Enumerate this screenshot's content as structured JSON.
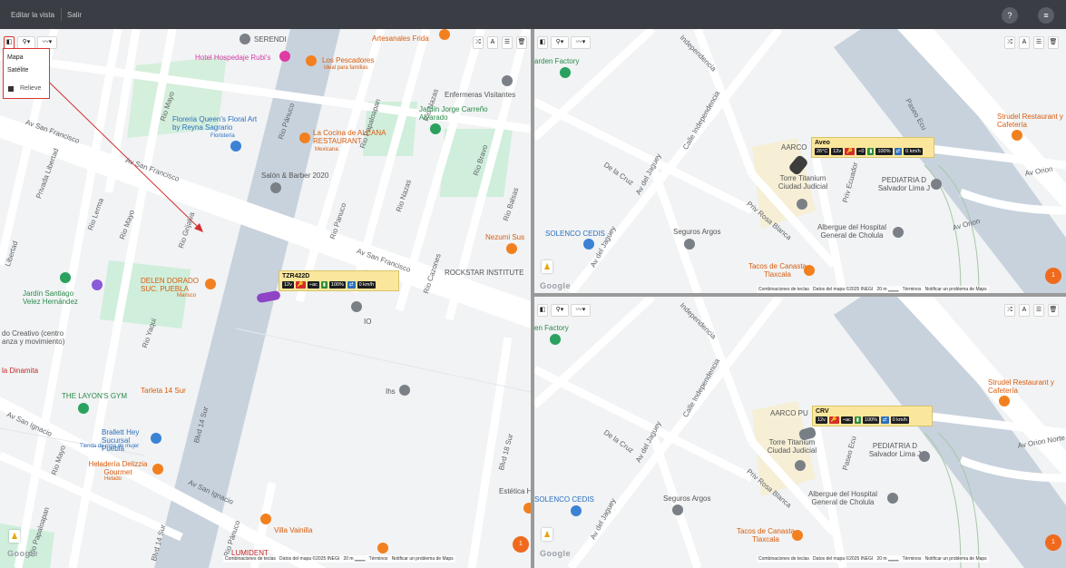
{
  "topbar": {
    "tabs": [
      "Editar la vista",
      "Salir"
    ],
    "right_icons": [
      "help-icon",
      "menu-icon"
    ],
    "help_glyph": "?",
    "menu_glyph": "≡"
  },
  "controls": {
    "layers_glyph": "◧",
    "pin_glyph": "⚲▾",
    "route_glyph": "〰▾",
    "shuffle_glyph": "⤮",
    "car_glyph": "A",
    "list_glyph": "☰",
    "trash_glyph": "🗑"
  },
  "menu": {
    "items": [
      "Mapa",
      "Satélite",
      "Relieve"
    ]
  },
  "map_left": {
    "places": [
      {
        "name": "SERENDI"
      },
      {
        "name": "Artesanales Frida"
      },
      {
        "name": "Hotel Hospedaje Rubi's"
      },
      {
        "name": "Los Pescadores",
        "sub": "Ideal para familias"
      },
      {
        "name": "Enfermeras Visitantes"
      },
      {
        "name": "Jardín Jorge Carreño Alvarado"
      },
      {
        "name": "Floreria Queen's Floral Art by Reyna Sagrario",
        "sub": "Floristería"
      },
      {
        "name": "La Cocina de ALEANA RESTAURANT",
        "sub": "Mexicana"
      },
      {
        "name": "Salón & Barber 2020"
      },
      {
        "name": "Nezumi Sus"
      },
      {
        "name": "ROCKSTAR INSTITUTE"
      },
      {
        "name": "DELEN DORADO SUC. PUEBLA",
        "sub": "Marisco"
      },
      {
        "name": "Jardín Santiago Velez Hernández"
      },
      {
        "name": "do Creativo (centro anza y movimiento)"
      },
      {
        "name": "la Dinamita"
      },
      {
        "name": "THE LAYON'S GYM"
      },
      {
        "name": "Tarleta 14 Sur"
      },
      {
        "name": "Brallett Hey Sucursal Puebla",
        "sub": "Tienda de ropa de mujer"
      },
      {
        "name": "Heladería Delizzia Gourmet",
        "sub": "Helado"
      },
      {
        "name": "Villa Vainilla"
      },
      {
        "name": "LUMIDENT"
      },
      {
        "name": "IO"
      },
      {
        "name": "Ihs"
      },
      {
        "name": "Estética H"
      }
    ],
    "roads": [
      "Av San Francisco",
      "Av San Francisco",
      "Av San Francisco",
      "Privada Libertad",
      "Rio Lerma",
      "Rio Mayo",
      "Rio Balsas",
      "Rio Grijalva",
      "Rio Panuco",
      "Rio Nazas",
      "Rio Papaloapan",
      "Rio Pánuco",
      "Rio Nazas",
      "Rio Cazones",
      "Rio Bravo",
      "Rio Mayo",
      "Rio Yaqui",
      "Av San Ignacio",
      "Av San Ignacio",
      "Blvd 14 Sur",
      "Blvd 14 Sur",
      "Blvd 18 Sur",
      "Rio Mayo",
      "Rio Papaloapan",
      "Rio Pánuco",
      "Libertad"
    ],
    "vehicle": {
      "name": "TZR422D",
      "chips": [
        "12v",
        "🔑",
        "⌁ac",
        "▮",
        "100%",
        "⇄",
        "0 km/h"
      ]
    },
    "footer": [
      "Combinaciones de teclas",
      "Datos del mapa ©2025 INEGI",
      "20 m",
      "Términos",
      "Notificar un problema de Maps"
    ],
    "google": "Google",
    "fab": "1"
  },
  "map_tr": {
    "places": [
      {
        "name": "arden Factory"
      },
      {
        "name": "AARCO"
      },
      {
        "name": "Strudel Restaurant y Cafetería"
      },
      {
        "name": "Torre Titanium Ciudad Judicial"
      },
      {
        "name": "PEDIATRIA D Salvador Lima J"
      },
      {
        "name": "Albergue del Hospital General de Cholula"
      },
      {
        "name": "Seguros Argos"
      },
      {
        "name": "SOLENCO CEDIS"
      },
      {
        "name": "Tacos de Canasta Tlaxcala"
      }
    ],
    "roads": [
      "Independencia",
      "Calle Independencia",
      "Av del Jaguey",
      "Av del Jaguey",
      "Av Orion",
      "Priv Ecuador",
      "Av Orion",
      "Priv Rosa Blanca",
      "De la Cruz",
      "Paseo Ecu"
    ],
    "vehicle": {
      "name": "Aveo",
      "chips": [
        "26°C",
        "12v",
        "🔑",
        "⌁0",
        "▮",
        "100%",
        "⇄",
        "0 km/h"
      ]
    },
    "footer": [
      "Combinaciones de teclas",
      "Datos del mapa ©2025 INEGI",
      "20 m",
      "Términos",
      "Notificar un problema de Maps"
    ],
    "google": "Google",
    "fab": "1"
  },
  "map_br": {
    "places": [
      {
        "name": "en Factory"
      },
      {
        "name": "AARCO PU"
      },
      {
        "name": "Strudel Restaurant y Cafetería"
      },
      {
        "name": "Torre Titanium Ciudad Judicial"
      },
      {
        "name": "PEDIATRIA D Salvador Lima J"
      },
      {
        "name": "Albergue del Hospital General de Cholula"
      },
      {
        "name": "Seguros Argos"
      },
      {
        "name": "SOLENCO CEDIS"
      },
      {
        "name": "Tacos de Canasta Tlaxcala"
      }
    ],
    "roads": [
      "Independencia",
      "Calle Independencia",
      "Av del Jaguey",
      "Av del Jaguey",
      "Av Orion Norte",
      "Paseo Ecu",
      "Priv Rosa Blanca",
      "De la Cruz"
    ],
    "vehicle": {
      "name": "CRV",
      "chips": [
        "12v",
        "🔑",
        "⌁ac",
        "▮",
        "100%",
        "⇄",
        "0 km/h"
      ]
    },
    "footer": [
      "Combinaciones de teclas",
      "Datos del mapa ©2025 INEGI",
      "20 m",
      "Términos",
      "Notificar un problema de Maps"
    ],
    "google": "Google",
    "fab": "1"
  },
  "colors": {
    "topbar": "#3a3d43",
    "map_bg": "#f1f3f4",
    "road": "#ffffff",
    "main_road": "#c8d2dd",
    "park": "#cfeedb",
    "info_bg": "#fbe79c",
    "annotation": "#d32f2f"
  }
}
